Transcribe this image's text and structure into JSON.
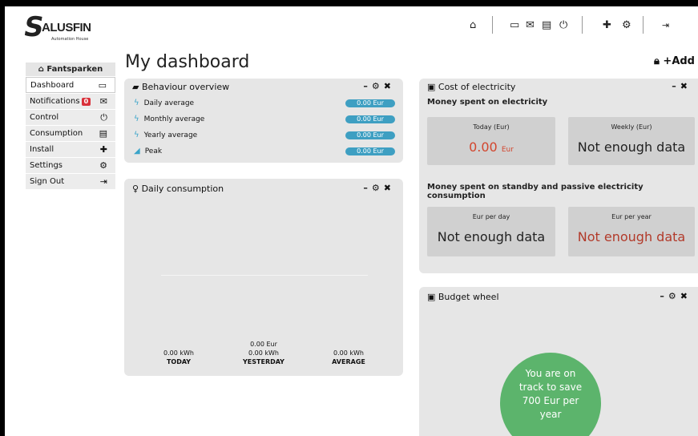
{
  "brand": {
    "logo_text": "ALUSFIN",
    "logo_mark": "S",
    "tagline": "Automation House"
  },
  "page_title": "My dashboard",
  "add_label": "+Add",
  "sidebar": {
    "header": "Fantsparken",
    "items": [
      {
        "label": "Dashboard",
        "icon": "monitor-icon",
        "glyph": "▭"
      },
      {
        "label": "Notifications",
        "icon": "envelope-icon",
        "glyph": "✉",
        "badge": "0"
      },
      {
        "label": "Control",
        "icon": "power-icon",
        "glyph": "⏻"
      },
      {
        "label": "Consumption",
        "icon": "chart-icon",
        "glyph": "▤"
      },
      {
        "label": "Install",
        "icon": "plus-icon",
        "glyph": "✚"
      },
      {
        "label": "Settings",
        "icon": "gear-icon",
        "glyph": "⚙"
      },
      {
        "label": "Sign Out",
        "icon": "sign-out-icon",
        "glyph": "⇥"
      }
    ]
  },
  "behaviour": {
    "title": "Behaviour overview",
    "rows": [
      {
        "label": "Daily average",
        "value": "0.00 Eur"
      },
      {
        "label": "Monthly average",
        "value": "0.00 Eur"
      },
      {
        "label": "Yearly average",
        "value": "0.00 Eur"
      },
      {
        "label": "Peak",
        "value": "0.00 Eur"
      }
    ]
  },
  "daily": {
    "title": "Daily consumption",
    "today_value": "0.00 kWh",
    "today_label": "TODAY",
    "yesterday_eur": "0.00 Eur",
    "yesterday_value": "0.00 kWh",
    "yesterday_label": "YESTERDAY",
    "average_value": "0.00 kWh",
    "average_label": "AVERAGE"
  },
  "cost": {
    "title": "Cost of electricity",
    "section1": "Money spent on electricity",
    "today_label": "Today (Eur)",
    "today_value": "0.00",
    "today_unit": "Eur",
    "weekly_label": "Weekly (Eur)",
    "weekly_value": "Not enough data",
    "section2": "Money spent on standby and passive electricity consumption",
    "day_label": "Eur per day",
    "day_value": "Not enough data",
    "year_label": "Eur per year",
    "year_value": "Not enough data"
  },
  "budget": {
    "title": "Budget wheel",
    "message": "You are on track to save 700 Eur per year"
  },
  "colors": {
    "accent_blue": "#3e9fc2",
    "alert_red": "#b23a2a",
    "money_red": "#d2462e",
    "wheel_green": "#5cb46c"
  }
}
